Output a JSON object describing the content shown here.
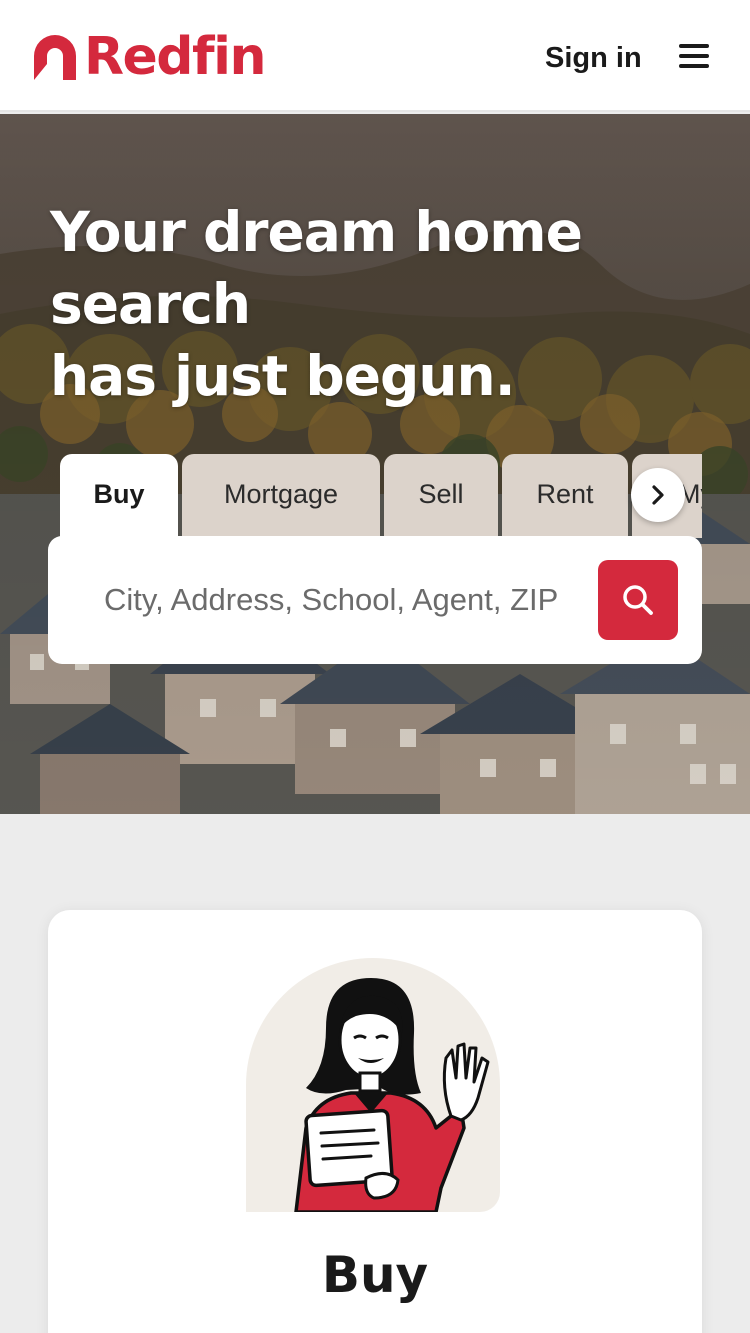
{
  "header": {
    "brand": "Redfin",
    "sign_in_label": "Sign in",
    "brand_color": "#d4293d"
  },
  "hero": {
    "title_lines": [
      "Your dream home",
      "search",
      "has just begun."
    ],
    "tabs": [
      {
        "label": "Buy",
        "active": true
      },
      {
        "label": "Mortgage",
        "active": false
      },
      {
        "label": "Sell",
        "active": false
      },
      {
        "label": "Rent",
        "active": false
      },
      {
        "label": "My",
        "active": false
      }
    ],
    "search_placeholder": "City, Address, School, Agent, ZIP"
  },
  "card": {
    "title": "Buy"
  },
  "icons": {
    "menu": "hamburger-menu-icon",
    "arrow": "chevron-right-icon",
    "search": "search-icon"
  }
}
